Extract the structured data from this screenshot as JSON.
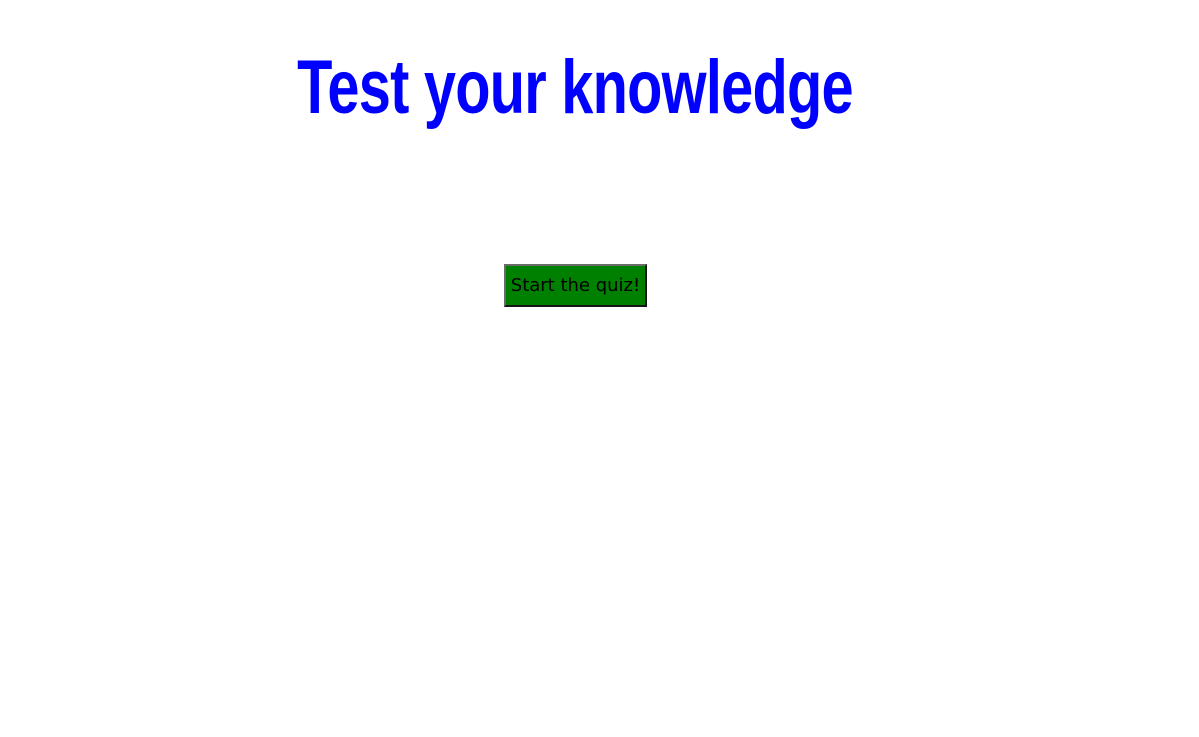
{
  "page": {
    "title": "Test your knowledge",
    "start_button_label": "Start the quiz!"
  },
  "colors": {
    "title": "#0000ff",
    "button_bg": "#008000",
    "button_text": "#000000"
  }
}
